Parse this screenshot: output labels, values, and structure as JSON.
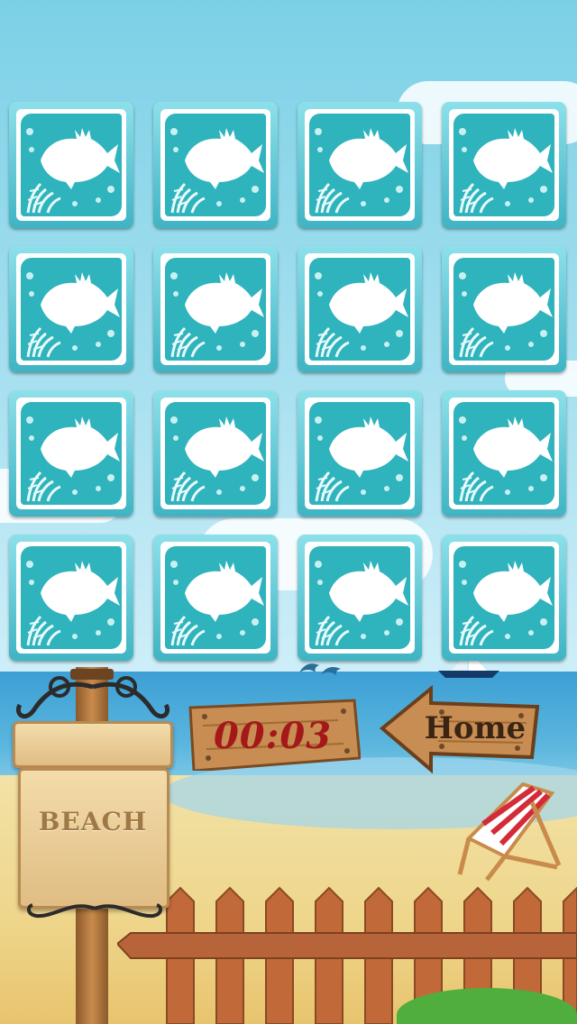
{
  "game": {
    "theme_label": "BEACH",
    "timer": "00:03",
    "home_label": "Home",
    "cards": [
      {
        "state": "face-down",
        "icon": "fish-icon"
      },
      {
        "state": "face-down",
        "icon": "fish-icon"
      },
      {
        "state": "face-down",
        "icon": "fish-icon"
      },
      {
        "state": "face-down",
        "icon": "fish-icon"
      },
      {
        "state": "face-down",
        "icon": "fish-icon"
      },
      {
        "state": "face-down",
        "icon": "fish-icon"
      },
      {
        "state": "face-down",
        "icon": "fish-icon"
      },
      {
        "state": "face-down",
        "icon": "fish-icon"
      },
      {
        "state": "face-down",
        "icon": "fish-icon"
      },
      {
        "state": "face-down",
        "icon": "fish-icon"
      },
      {
        "state": "face-down",
        "icon": "fish-icon"
      },
      {
        "state": "face-down",
        "icon": "fish-icon"
      },
      {
        "state": "face-down",
        "icon": "fish-icon"
      },
      {
        "state": "face-down",
        "icon": "fish-icon"
      },
      {
        "state": "face-down",
        "icon": "fish-icon"
      },
      {
        "state": "face-down",
        "icon": "fish-icon"
      }
    ]
  },
  "colors": {
    "card_back": "#2fb3bd",
    "timer_text": "#a4181a",
    "sky": "#7cd0e6",
    "sea": "#3c9fd4",
    "sand": "#eed58a",
    "wood": "#c98b4c"
  }
}
